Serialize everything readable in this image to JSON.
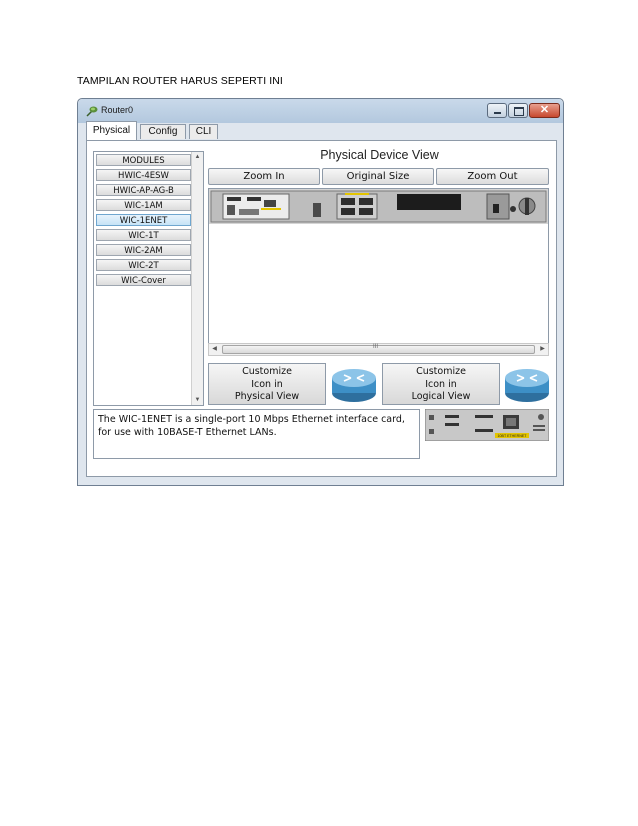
{
  "document": {
    "heading": "TAMPILAN ROUTER HARUS SEPERTI INI"
  },
  "window": {
    "title": "Router0",
    "controls": {
      "close": "✕"
    },
    "tabs": [
      {
        "label": "Physical"
      },
      {
        "label": "Config"
      },
      {
        "label": "CLI"
      }
    ]
  },
  "modules": {
    "items": [
      {
        "label": "MODULES"
      },
      {
        "label": "HWIC-4ESW"
      },
      {
        "label": "HWIC-AP-AG-B"
      },
      {
        "label": "WIC-1AM"
      },
      {
        "label": "WIC-1ENET"
      },
      {
        "label": "WIC-1T"
      },
      {
        "label": "WIC-2AM"
      },
      {
        "label": "WIC-2T"
      },
      {
        "label": "WIC-Cover"
      }
    ],
    "selected": "WIC-1ENET"
  },
  "physical_view": {
    "title": "Physical Device View",
    "zoom_in": "Zoom In",
    "original_size": "Original Size",
    "zoom_out": "Zoom Out",
    "scroll_grip": "III"
  },
  "customize": {
    "physical": [
      "Customize",
      "Icon in",
      "Physical View"
    ],
    "logical": [
      "Customize",
      "Icon in",
      "Logical View"
    ]
  },
  "description": "The WIC-1ENET is a single-port 10 Mbps Ethernet interface card, for use with 10BASE-T Ethernet LANs.",
  "module_image": {
    "port_label": "10BT ETHERNET"
  },
  "colors": {
    "accent": "#c6e3f6",
    "router_icon": "#3d8fc6",
    "title_bar": "#c9d9ea"
  }
}
